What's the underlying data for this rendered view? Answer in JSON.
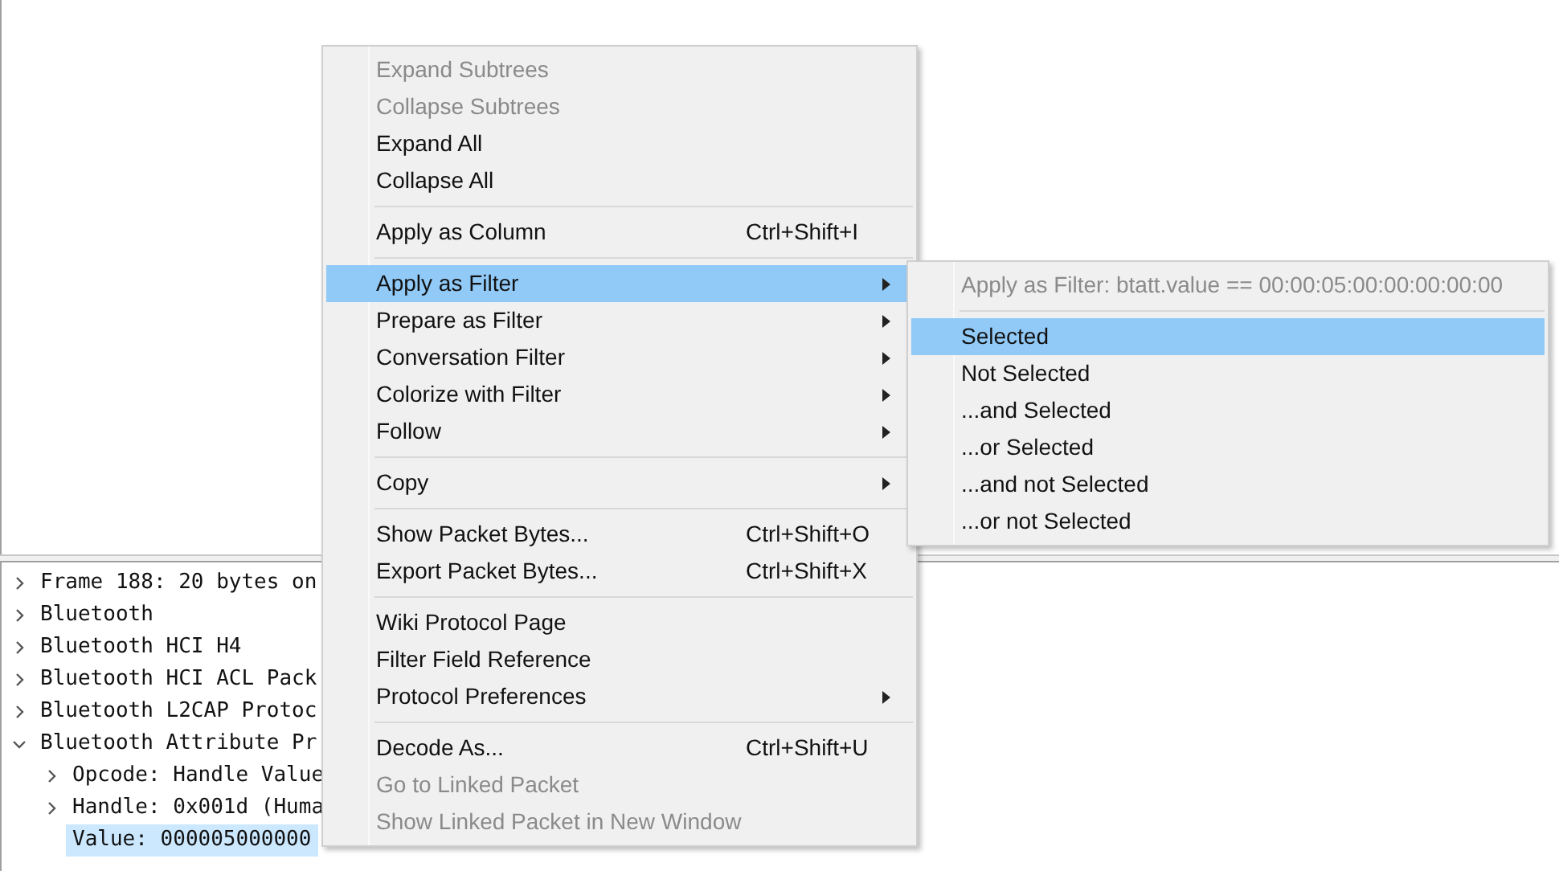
{
  "tree": [
    {
      "label": "Frame 188: 20 bytes on",
      "expanded": false,
      "selected": false
    },
    {
      "label": "Bluetooth",
      "expanded": false,
      "selected": false
    },
    {
      "label": "Bluetooth HCI H4",
      "expanded": false,
      "selected": false
    },
    {
      "label": "Bluetooth HCI ACL Pack",
      "expanded": false,
      "selected": false
    },
    {
      "label": "Bluetooth L2CAP Protoc",
      "expanded": false,
      "selected": false
    },
    {
      "label": "Bluetooth Attribute Pr",
      "expanded": true,
      "selected": false,
      "children": [
        {
          "label": "Opcode: Handle Value",
          "expanded": false,
          "selected": false
        },
        {
          "label": "Handle: 0x001d (Huma",
          "expanded": false,
          "selected": false
        },
        {
          "label": "Value: 000005000000",
          "selected": true
        }
      ]
    }
  ],
  "context_menu": [
    {
      "kind": "item",
      "label": "Expand Subtrees",
      "disabled": true,
      "selected": false,
      "submenu": false
    },
    {
      "kind": "item",
      "label": "Collapse Subtrees",
      "disabled": true,
      "selected": false,
      "submenu": false
    },
    {
      "kind": "item",
      "label": "Expand All",
      "disabled": false,
      "selected": false,
      "submenu": false
    },
    {
      "kind": "item",
      "label": "Collapse All",
      "disabled": false,
      "selected": false,
      "submenu": false
    },
    {
      "kind": "separator"
    },
    {
      "kind": "item",
      "label": "Apply as Column",
      "shortcut": "Ctrl+Shift+I",
      "disabled": false,
      "selected": false,
      "submenu": false
    },
    {
      "kind": "separator"
    },
    {
      "kind": "item",
      "label": "Apply as Filter",
      "disabled": false,
      "selected": true,
      "submenu": true
    },
    {
      "kind": "item",
      "label": "Prepare as Filter",
      "disabled": false,
      "selected": false,
      "submenu": true
    },
    {
      "kind": "item",
      "label": "Conversation Filter",
      "disabled": false,
      "selected": false,
      "submenu": true
    },
    {
      "kind": "item",
      "label": "Colorize with Filter",
      "disabled": false,
      "selected": false,
      "submenu": true
    },
    {
      "kind": "item",
      "label": "Follow",
      "disabled": false,
      "selected": false,
      "submenu": true
    },
    {
      "kind": "separator"
    },
    {
      "kind": "item",
      "label": "Copy",
      "disabled": false,
      "selected": false,
      "submenu": true
    },
    {
      "kind": "separator"
    },
    {
      "kind": "item",
      "label": "Show Packet Bytes...",
      "shortcut": "Ctrl+Shift+O",
      "disabled": false,
      "selected": false,
      "submenu": false
    },
    {
      "kind": "item",
      "label": "Export Packet Bytes...",
      "shortcut": "Ctrl+Shift+X",
      "disabled": false,
      "selected": false,
      "submenu": false
    },
    {
      "kind": "separator"
    },
    {
      "kind": "item",
      "label": "Wiki Protocol Page",
      "disabled": false,
      "selected": false,
      "submenu": false
    },
    {
      "kind": "item",
      "label": "Filter Field Reference",
      "disabled": false,
      "selected": false,
      "submenu": false
    },
    {
      "kind": "item",
      "label": "Protocol Preferences",
      "disabled": false,
      "selected": false,
      "submenu": true
    },
    {
      "kind": "separator"
    },
    {
      "kind": "item",
      "label": "Decode As...",
      "shortcut": "Ctrl+Shift+U",
      "disabled": false,
      "selected": false,
      "submenu": false
    },
    {
      "kind": "item",
      "label": "Go to Linked Packet",
      "disabled": true,
      "selected": false,
      "submenu": false
    },
    {
      "kind": "item",
      "label": "Show Linked Packet in New Window",
      "disabled": true,
      "selected": false,
      "submenu": false
    }
  ],
  "submenu": [
    {
      "kind": "item",
      "label": "Apply as Filter: btatt.value == 00:00:05:00:00:00:00:00",
      "disabled": true,
      "selected": false
    },
    {
      "kind": "separator"
    },
    {
      "kind": "item",
      "label": "Selected",
      "disabled": false,
      "selected": true
    },
    {
      "kind": "item",
      "label": "Not Selected",
      "disabled": false,
      "selected": false
    },
    {
      "kind": "item",
      "label": "...and Selected",
      "disabled": false,
      "selected": false
    },
    {
      "kind": "item",
      "label": "...or Selected",
      "disabled": false,
      "selected": false
    },
    {
      "kind": "item",
      "label": "...and not Selected",
      "disabled": false,
      "selected": false
    },
    {
      "kind": "item",
      "label": "...or not Selected",
      "disabled": false,
      "selected": false
    }
  ]
}
